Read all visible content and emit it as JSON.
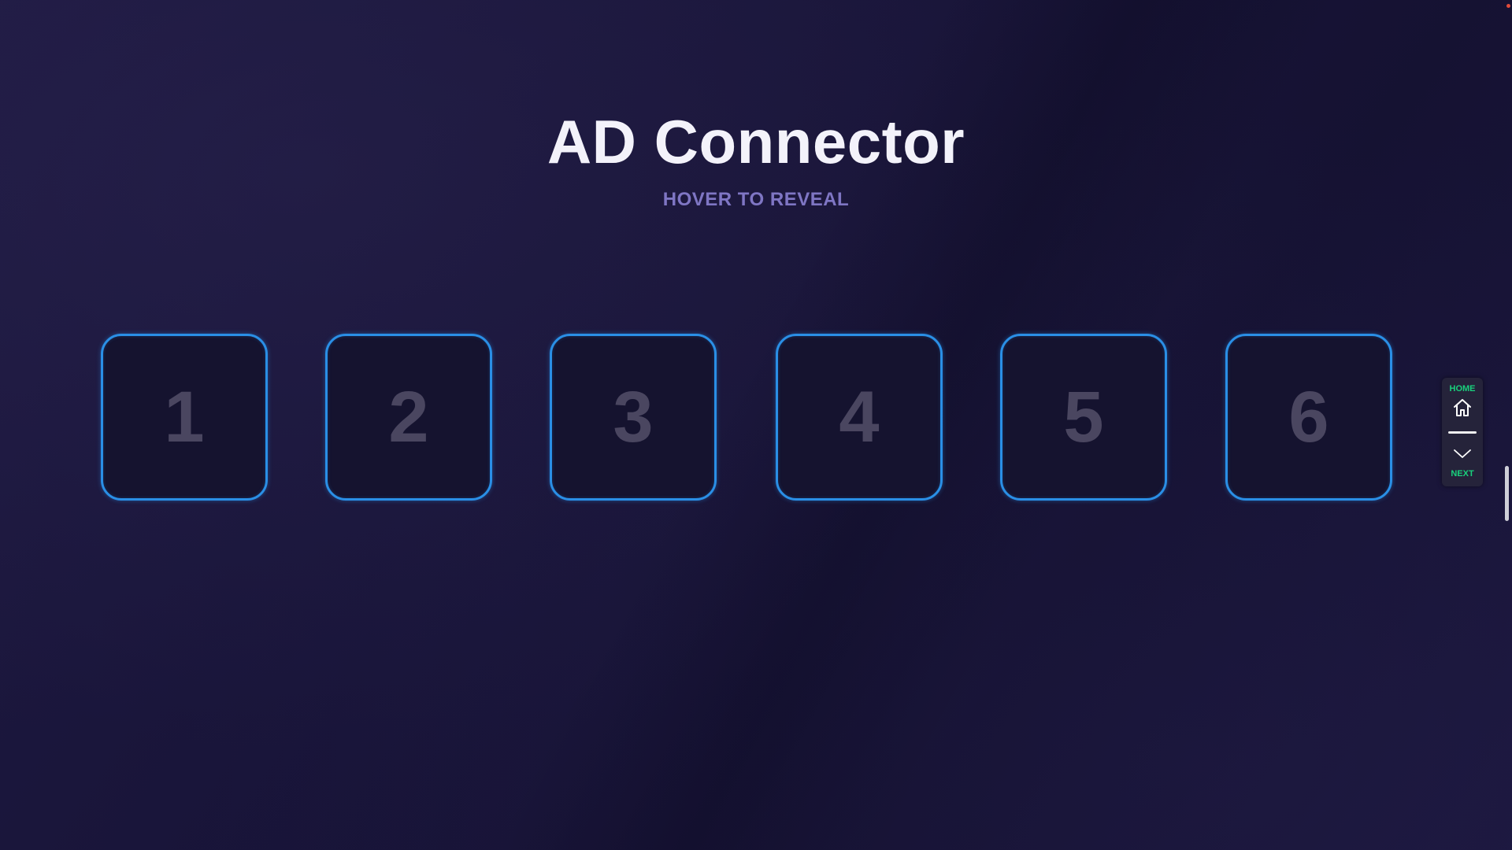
{
  "page": {
    "title": "AD Connector",
    "subtitle": "HOVER TO REVEAL"
  },
  "cards": [
    {
      "number": "1"
    },
    {
      "number": "2"
    },
    {
      "number": "3"
    },
    {
      "number": "4"
    },
    {
      "number": "5"
    },
    {
      "number": "6"
    }
  ],
  "nav": {
    "home_label": "HOME",
    "next_label": "NEXT",
    "home_icon": "home-icon",
    "next_icon": "chevron-down-icon"
  },
  "colors": {
    "background": "#19153a",
    "card_border": "#2a8fe6",
    "card_number": "#4a4660",
    "subtitle": "#7f76c4",
    "nav_accent": "#19d07c"
  }
}
